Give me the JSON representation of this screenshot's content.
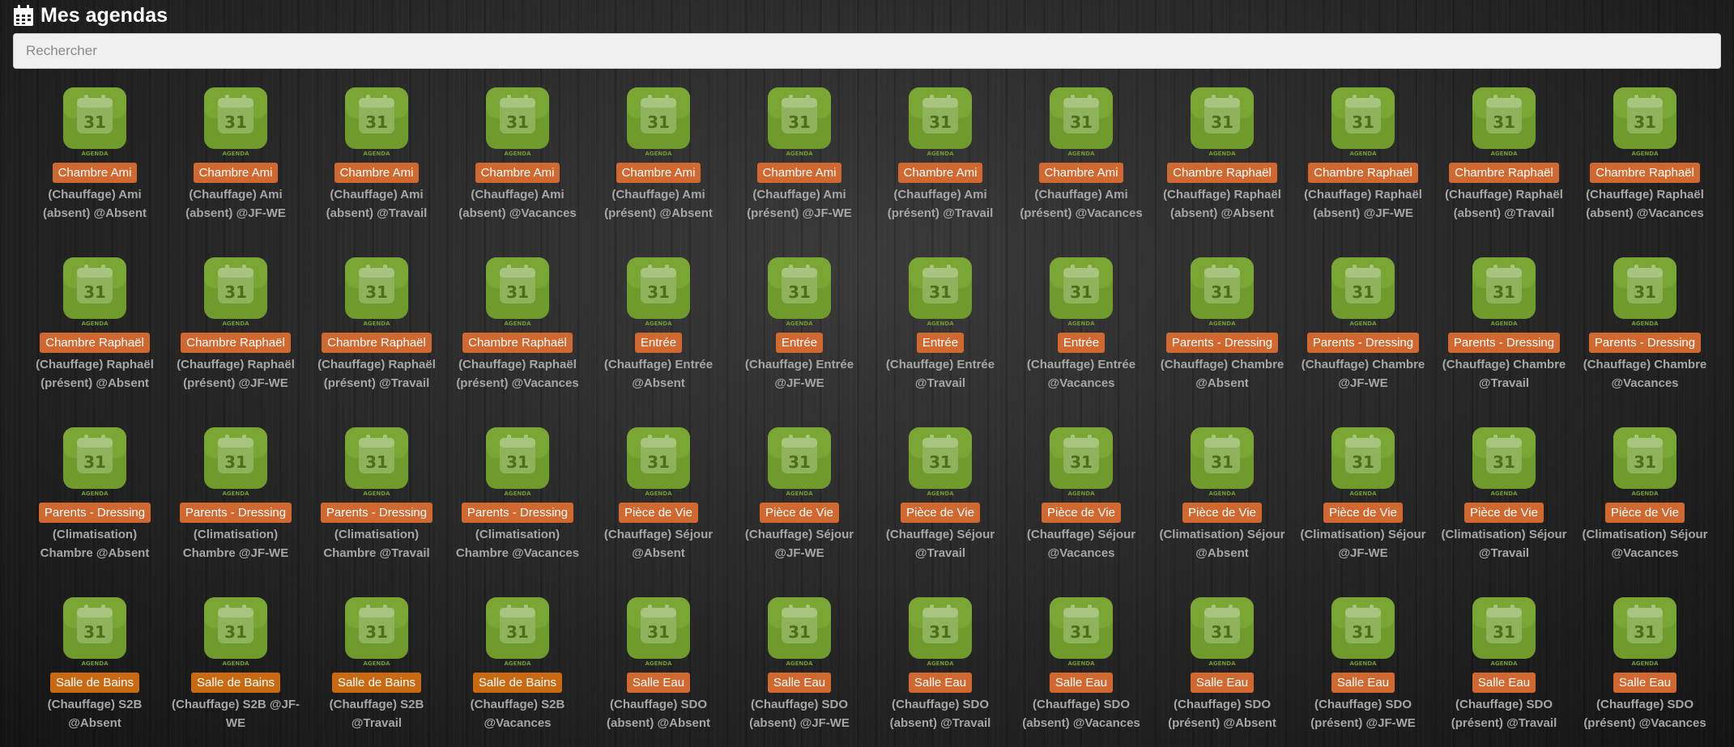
{
  "header": {
    "title": "Mes agendas",
    "icon": "calendar-icon"
  },
  "search": {
    "placeholder": "Rechercher",
    "value": ""
  },
  "colors": {
    "icon_green": "#6f9a2c",
    "badge_orange": "#d0682f",
    "badge_amber": "#c96a12",
    "name_gray": "#a6a6a6"
  },
  "agenda_icon": {
    "day_number": "31",
    "caption": "AGENDA"
  },
  "agendas": [
    {
      "room": "Chambre Ami",
      "name": "(Chauffage) Ami (absent) @Absent"
    },
    {
      "room": "Chambre Ami",
      "name": "(Chauffage) Ami (absent) @JF-WE"
    },
    {
      "room": "Chambre Ami",
      "name": "(Chauffage) Ami (absent) @Travail"
    },
    {
      "room": "Chambre Ami",
      "name": "(Chauffage) Ami (absent) @Vacances"
    },
    {
      "room": "Chambre Ami",
      "name": "(Chauffage) Ami (présent) @Absent"
    },
    {
      "room": "Chambre Ami",
      "name": "(Chauffage) Ami (présent) @JF-WE"
    },
    {
      "room": "Chambre Ami",
      "name": "(Chauffage) Ami (présent) @Travail"
    },
    {
      "room": "Chambre Ami",
      "name": "(Chauffage) Ami (présent) @Vacances"
    },
    {
      "room": "Chambre Raphaël",
      "name": "(Chauffage) Raphaël (absent) @Absent"
    },
    {
      "room": "Chambre Raphaël",
      "name": "(Chauffage) Raphaël (absent) @JF-WE"
    },
    {
      "room": "Chambre Raphaël",
      "name": "(Chauffage) Raphaël (absent) @Travail"
    },
    {
      "room": "Chambre Raphaël",
      "name": "(Chauffage) Raphaël (absent) @Vacances"
    },
    {
      "room": "Chambre Raphaël",
      "name": "(Chauffage) Raphaël (présent) @Absent"
    },
    {
      "room": "Chambre Raphaël",
      "name": "(Chauffage) Raphaël (présent) @JF-WE"
    },
    {
      "room": "Chambre Raphaël",
      "name": "(Chauffage) Raphaël (présent) @Travail"
    },
    {
      "room": "Chambre Raphaël",
      "name": "(Chauffage) Raphaël (présent) @Vacances"
    },
    {
      "room": "Entrée",
      "name": "(Chauffage) Entrée @Absent"
    },
    {
      "room": "Entrée",
      "name": "(Chauffage) Entrée @JF-WE"
    },
    {
      "room": "Entrée",
      "name": "(Chauffage) Entrée @Travail"
    },
    {
      "room": "Entrée",
      "name": "(Chauffage) Entrée @Vacances"
    },
    {
      "room": "Parents - Dressing",
      "name": "(Chauffage) Chambre @Absent"
    },
    {
      "room": "Parents - Dressing",
      "name": "(Chauffage) Chambre @JF-WE"
    },
    {
      "room": "Parents - Dressing",
      "name": "(Chauffage) Chambre @Travail"
    },
    {
      "room": "Parents - Dressing",
      "name": "(Chauffage) Chambre @Vacances"
    },
    {
      "room": "Parents - Dressing",
      "name": "(Climatisation) Chambre @Absent"
    },
    {
      "room": "Parents - Dressing",
      "name": "(Climatisation) Chambre @JF-WE"
    },
    {
      "room": "Parents - Dressing",
      "name": "(Climatisation) Chambre @Travail"
    },
    {
      "room": "Parents - Dressing",
      "name": "(Climatisation) Chambre @Vacances"
    },
    {
      "room": "Pièce de Vie",
      "name": "(Chauffage) Séjour @Absent"
    },
    {
      "room": "Pièce de Vie",
      "name": "(Chauffage) Séjour @JF-WE"
    },
    {
      "room": "Pièce de Vie",
      "name": "(Chauffage) Séjour @Travail"
    },
    {
      "room": "Pièce de Vie",
      "name": "(Chauffage) Séjour @Vacances"
    },
    {
      "room": "Pièce de Vie",
      "name": "(Climatisation) Séjour @Absent"
    },
    {
      "room": "Pièce de Vie",
      "name": "(Climatisation) Séjour @JF-WE"
    },
    {
      "room": "Pièce de Vie",
      "name": "(Climatisation) Séjour @Travail"
    },
    {
      "room": "Pièce de Vie",
      "name": "(Climatisation) Séjour @Vacances"
    },
    {
      "room": "Salle de Bains",
      "name": "(Chauffage) S2B @Absent",
      "badge": "amber"
    },
    {
      "room": "Salle de Bains",
      "name": "(Chauffage) S2B @JF-WE",
      "badge": "amber"
    },
    {
      "room": "Salle de Bains",
      "name": "(Chauffage) S2B @Travail",
      "badge": "amber"
    },
    {
      "room": "Salle de Bains",
      "name": "(Chauffage) S2B @Vacances",
      "badge": "amber"
    },
    {
      "room": "Salle Eau",
      "name": "(Chauffage) SDO (absent) @Absent"
    },
    {
      "room": "Salle Eau",
      "name": "(Chauffage) SDO (absent) @JF-WE"
    },
    {
      "room": "Salle Eau",
      "name": "(Chauffage) SDO (absent) @Travail"
    },
    {
      "room": "Salle Eau",
      "name": "(Chauffage) SDO (absent) @Vacances"
    },
    {
      "room": "Salle Eau",
      "name": "(Chauffage) SDO (présent) @Absent"
    },
    {
      "room": "Salle Eau",
      "name": "(Chauffage) SDO (présent) @JF-WE"
    },
    {
      "room": "Salle Eau",
      "name": "(Chauffage) SDO (présent) @Travail"
    },
    {
      "room": "Salle Eau",
      "name": "(Chauffage) SDO (présent) @Vacances"
    }
  ]
}
